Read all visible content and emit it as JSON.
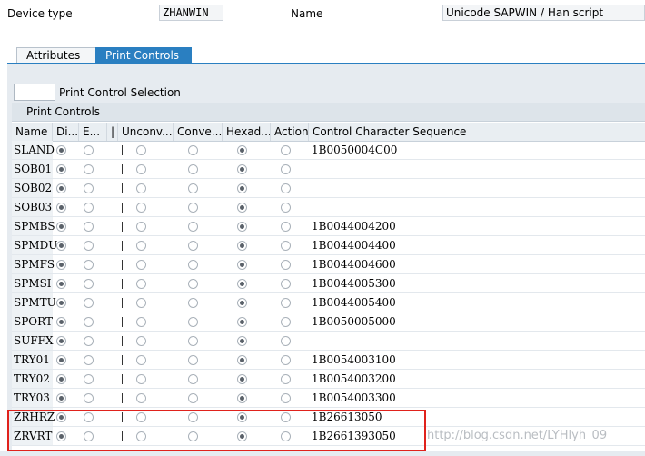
{
  "header": {
    "device_type_label": "Device type",
    "device_type_value": "ZHANWIN",
    "name_label": "Name",
    "name_value": "Unicode SAPWIN / Han script"
  },
  "tabs": [
    {
      "label": "Attributes",
      "active": false
    },
    {
      "label": "Print Controls",
      "active": true
    }
  ],
  "selection_label": "Print Control Selection",
  "table": {
    "title": "Print Controls",
    "columns": [
      "Name",
      "Di...",
      "E...",
      "|",
      "Unconv...",
      "Conve...",
      "Hexad...",
      "Action",
      "Control Character Sequence"
    ],
    "rows": [
      {
        "name": "SLAND",
        "sel": [
          1,
          0,
          0,
          0,
          1,
          0
        ],
        "seq": "1B0050004C00"
      },
      {
        "name": "SOB01",
        "sel": [
          1,
          0,
          0,
          0,
          1,
          0
        ],
        "seq": ""
      },
      {
        "name": "SOB02",
        "sel": [
          1,
          0,
          0,
          0,
          1,
          0
        ],
        "seq": ""
      },
      {
        "name": "SOB03",
        "sel": [
          1,
          0,
          0,
          0,
          1,
          0
        ],
        "seq": ""
      },
      {
        "name": "SPMBS",
        "sel": [
          1,
          0,
          0,
          0,
          1,
          0
        ],
        "seq": "1B0044004200"
      },
      {
        "name": "SPMDU",
        "sel": [
          1,
          0,
          0,
          0,
          1,
          0
        ],
        "seq": "1B0044004400"
      },
      {
        "name": "SPMFS",
        "sel": [
          1,
          0,
          0,
          0,
          1,
          0
        ],
        "seq": "1B0044004600"
      },
      {
        "name": "SPMSI",
        "sel": [
          1,
          0,
          0,
          0,
          1,
          0
        ],
        "seq": "1B0044005300"
      },
      {
        "name": "SPMTU",
        "sel": [
          1,
          0,
          0,
          0,
          1,
          0
        ],
        "seq": "1B0044005400"
      },
      {
        "name": "SPORT",
        "sel": [
          1,
          0,
          0,
          0,
          1,
          0
        ],
        "seq": "1B0050005000"
      },
      {
        "name": "SUFFX",
        "sel": [
          1,
          0,
          0,
          0,
          1,
          0
        ],
        "seq": ""
      },
      {
        "name": "TRY01",
        "sel": [
          1,
          0,
          0,
          0,
          1,
          0
        ],
        "seq": "1B0054003100"
      },
      {
        "name": "TRY02",
        "sel": [
          1,
          0,
          0,
          0,
          1,
          0
        ],
        "seq": "1B0054003200"
      },
      {
        "name": "TRY03",
        "sel": [
          1,
          0,
          0,
          0,
          1,
          0
        ],
        "seq": "1B0054003300"
      },
      {
        "name": "ZRHRZ",
        "sel": [
          1,
          0,
          0,
          0,
          1,
          0
        ],
        "seq": "1B26613050"
      },
      {
        "name": "ZRVRT",
        "sel": [
          1,
          0,
          0,
          0,
          1,
          0
        ],
        "seq": "1B2661393050"
      }
    ]
  },
  "watermark": "http://blog.csdn.net/LYHlyh_09",
  "colors": {
    "accent": "#2a7fc1",
    "highlight": "#e0221c"
  }
}
